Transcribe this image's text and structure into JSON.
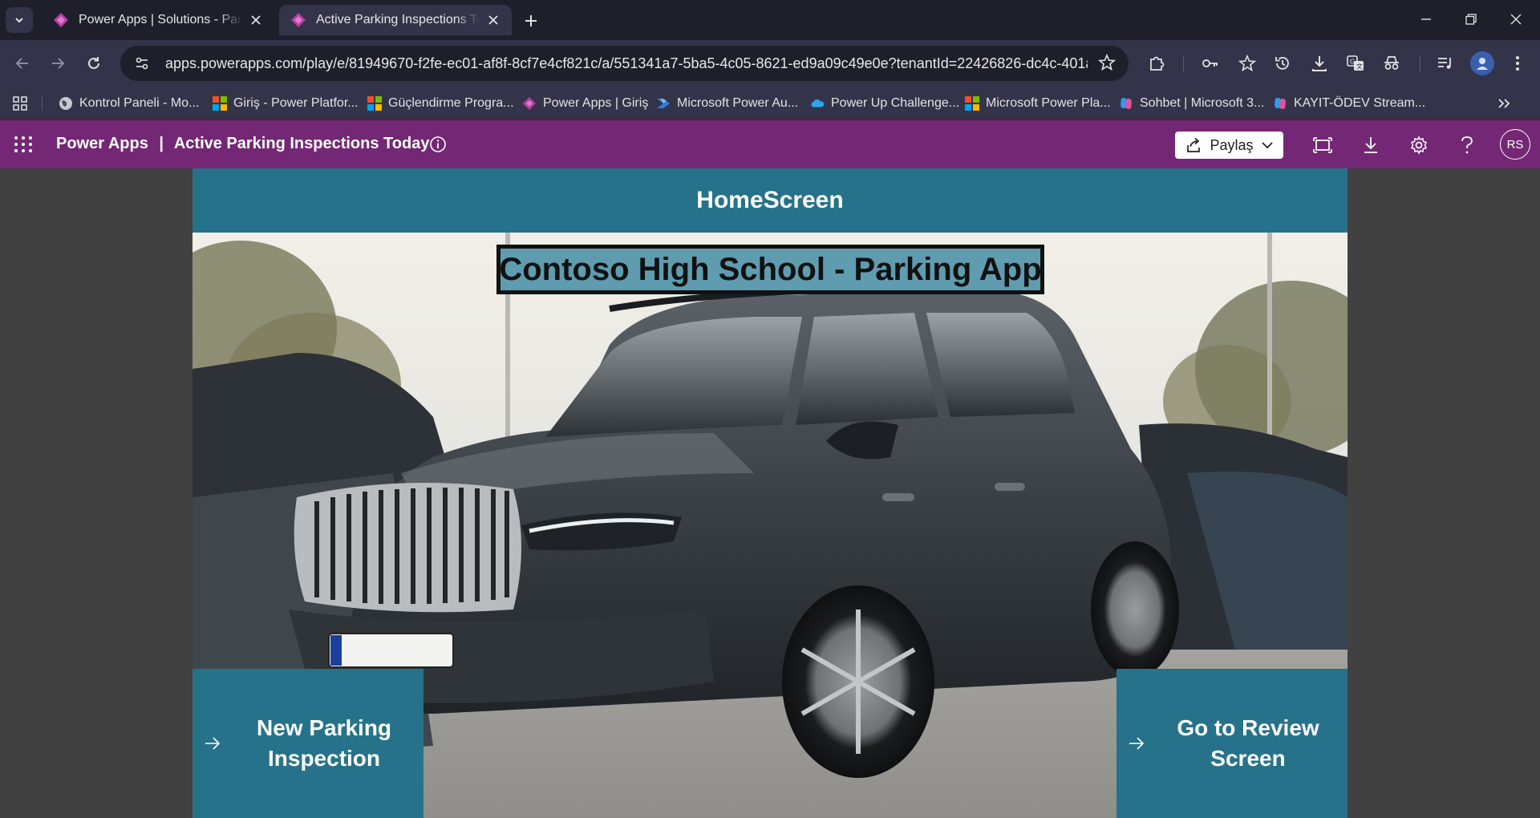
{
  "browser": {
    "tabs": [
      {
        "title": "Power Apps | Solutions - Parking Inspections",
        "active": false
      },
      {
        "title": "Active Parking Inspections Today",
        "active": true
      }
    ],
    "url": "apps.powerapps.com/play/e/81949670-f2fe-ec01-af8f-8cf7e4cf821c/a/551341a7-5ba5-4c05-8621-ed9a09c49e0e?tenantId=22426826-dc4c-401a-8...",
    "bookmarks": [
      {
        "label": "Kontrol Paneli - Mo...",
        "icon": "globe-icon"
      },
      {
        "label": "Giriş - Power Platfor...",
        "icon": "microsoft-logo-icon"
      },
      {
        "label": "Güçlendirme Progra...",
        "icon": "microsoft-logo-icon"
      },
      {
        "label": "Power Apps | Giriş",
        "icon": "power-apps-icon"
      },
      {
        "label": "Microsoft Power Au...",
        "icon": "power-automate-icon"
      },
      {
        "label": "Power Up Challenge...",
        "icon": "onedrive-icon"
      },
      {
        "label": "Microsoft Power Pla...",
        "icon": "microsoft-logo-icon"
      },
      {
        "label": "Sohbet | Microsoft 3...",
        "icon": "copilot-icon"
      },
      {
        "label": "KAYIT-ÖDEV Stream...",
        "icon": "copilot-icon"
      }
    ]
  },
  "header": {
    "brand": "Power Apps",
    "separator": "|",
    "app_name": "Active Parking Inspections Today",
    "share_label": "Paylaş",
    "user_initials": "RS",
    "color": "#742774"
  },
  "app": {
    "screen_name": "HomeScreen",
    "title": "Contoso High School - Parking App",
    "buttons": {
      "new_inspection": "New Parking Inspection",
      "review": "Go to Review Screen"
    },
    "accent": "#26728a"
  }
}
